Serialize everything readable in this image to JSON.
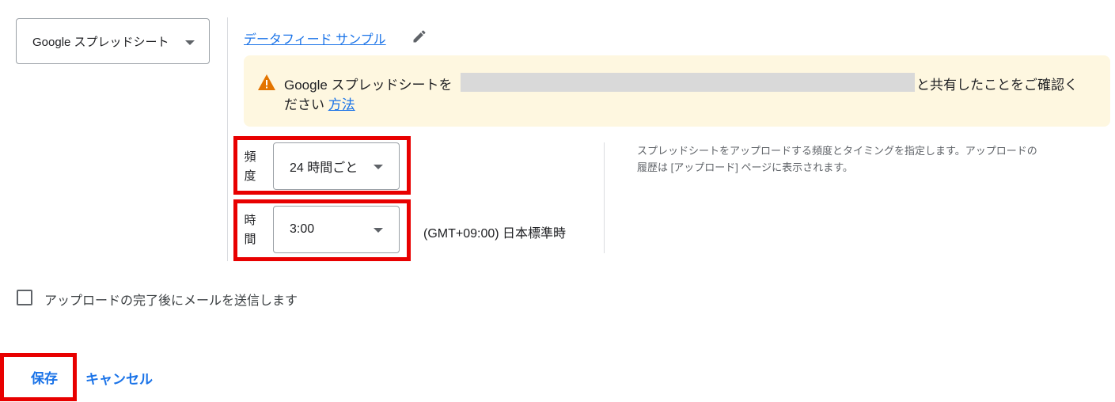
{
  "source": {
    "selected": "Google スプレッドシート",
    "icon": "caret-down-icon"
  },
  "feed": {
    "name": "データフィード サンプル",
    "edit_icon": "pencil-icon"
  },
  "banner": {
    "text_before": "Google スプレッドシートを",
    "text_after": "と共有したことをご確認く",
    "text_line2": "ださい",
    "link": "方法",
    "icon": "warning-icon"
  },
  "schedule": {
    "frequency_label": "頻度",
    "frequency_value": "24 時間ごと",
    "time_label": "時間",
    "time_value": "3:00",
    "timezone": "(GMT+09:00) 日本標準時",
    "help_line1": "スプレッドシートをアップロードする頻度とタイミングを指定します。アップロードの",
    "help_line2": "履歴は [アップロード] ページに表示されます。"
  },
  "notify": {
    "label": "アップロードの完了後にメールを送信します",
    "checked": false
  },
  "actions": {
    "save": "保存",
    "cancel": "キャンセル"
  },
  "colors": {
    "accent": "#1a73e8",
    "highlight": "#e80000",
    "banner_bg": "#fef7e0",
    "warning": "#e37400"
  }
}
